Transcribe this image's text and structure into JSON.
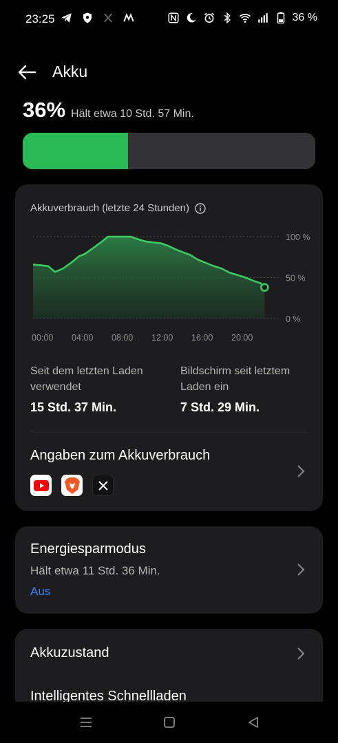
{
  "status_bar": {
    "time": "23:25",
    "battery_text": "36 %",
    "left_icons": [
      "telegram-icon",
      "shield-icon",
      "x-icon",
      "m-icon"
    ],
    "right_icons": [
      "nfc-icon",
      "moon-icon",
      "alarm-icon",
      "bluetooth-icon",
      "wifi-icon",
      "signal-icon",
      "battery-icon"
    ]
  },
  "header": {
    "title": "Akku"
  },
  "battery": {
    "percent_text": "36%",
    "level": 0.36,
    "remaining": "Hält etwa 10 Std. 57 Min.",
    "fill_color": "#2ab957",
    "track_color": "#333335"
  },
  "usage_card": {
    "chart_title": "Akkuverbrauch (letzte 24 Stunden)",
    "stat1_label": "Seit dem letzten Laden verwendet",
    "stat1_value": "15 Std. 37 Min.",
    "stat2_label": "Bildschirm seit letztem Laden ein",
    "stat2_value": "7 Std. 29 Min.",
    "details_title": "Angaben zum Akkuverbrauch",
    "apps": [
      "youtube-icon",
      "brave-icon",
      "x-app-icon"
    ]
  },
  "chart_data": {
    "type": "area",
    "xlabel": "",
    "ylabel": "",
    "x_ticks": [
      "00:00",
      "04:00",
      "08:00",
      "12:00",
      "16:00",
      "20:00"
    ],
    "y_ticks": [
      "100 %",
      "50 %",
      "0 %"
    ],
    "ylim": [
      0,
      100
    ],
    "xlim": [
      0,
      24
    ],
    "grid": true,
    "line_color": "#3ccb63",
    "x": [
      0,
      0.8,
      1.5,
      2.2,
      3.0,
      3.8,
      4.6,
      5.2,
      6.0,
      6.8,
      7.5,
      8.2,
      9.0,
      9.8,
      10.5,
      11.3,
      12.0,
      12.8,
      13.5,
      14.2,
      15.0,
      15.7,
      16.5,
      17.3,
      18.1,
      18.9,
      19.7,
      20.5,
      21.3,
      22.1,
      22.8,
      23.2
    ],
    "y": [
      66,
      65,
      64,
      57,
      61,
      68,
      76,
      79,
      86,
      93,
      100,
      100,
      100,
      100,
      97,
      94,
      93,
      92,
      89,
      85,
      81,
      78,
      72,
      68,
      64,
      61,
      56,
      53,
      50,
      46,
      43,
      38
    ]
  },
  "power_saver": {
    "title": "Energiesparmodus",
    "subtitle": "Hält etwa 11 Std. 36 Min.",
    "status": "Aus"
  },
  "settings_rows": {
    "health": "Akkuzustand",
    "fast_charge": "Intelligentes Schnellladen"
  },
  "nav_bar": {
    "buttons": [
      "menu-icon",
      "home-icon",
      "back-icon"
    ]
  }
}
